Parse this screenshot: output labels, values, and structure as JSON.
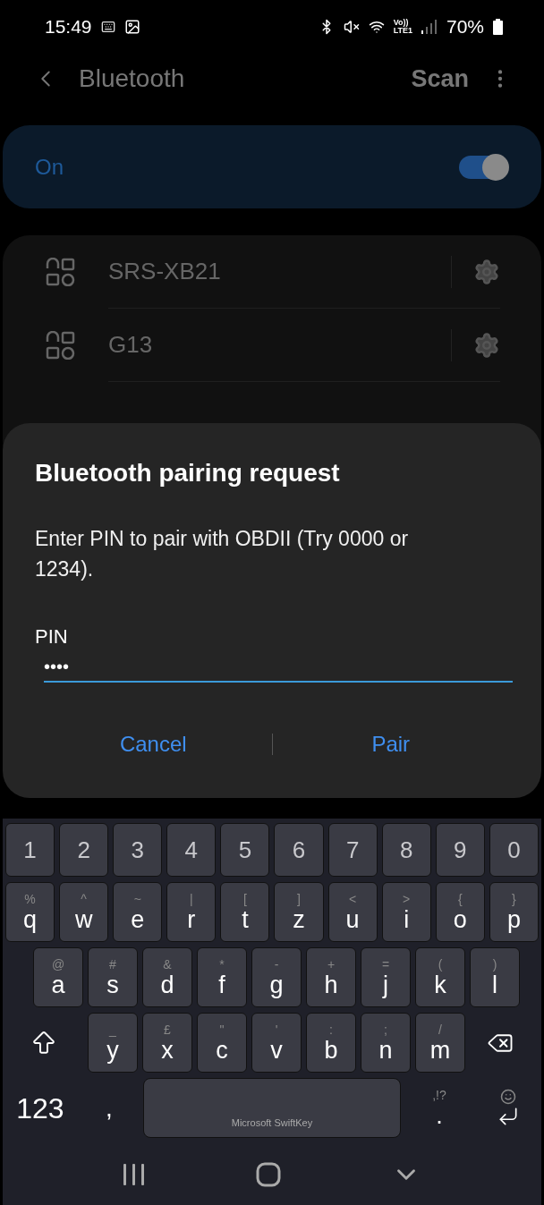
{
  "status_bar": {
    "time": "15:49",
    "volte": "Vo))",
    "network": "LTE1",
    "battery": "70%"
  },
  "app_bar": {
    "title": "Bluetooth",
    "action": "Scan"
  },
  "master_switch": {
    "label": "On",
    "on": true
  },
  "devices": [
    {
      "name": "SRS-XB21"
    },
    {
      "name": "G13"
    }
  ],
  "dialog": {
    "title": "Bluetooth pairing request",
    "message": "Enter PIN to pair with OBDII (Try 0000 or 1234).",
    "field_label": "PIN",
    "field_value": "••••",
    "buttons": [
      "Cancel",
      "Pair"
    ]
  },
  "keyboard": {
    "number_row": [
      "1",
      "2",
      "3",
      "4",
      "5",
      "6",
      "7",
      "8",
      "9",
      "0"
    ],
    "letter_rows": [
      [
        {
          "hint": "%",
          "letter": "q"
        },
        {
          "hint": "^",
          "letter": "w"
        },
        {
          "hint": "~",
          "letter": "e"
        },
        {
          "hint": "|",
          "letter": "r"
        },
        {
          "hint": "[",
          "letter": "t"
        },
        {
          "hint": "]",
          "letter": "z"
        },
        {
          "hint": "<",
          "letter": "u"
        },
        {
          "hint": ">",
          "letter": "i"
        },
        {
          "hint": "{",
          "letter": "o"
        },
        {
          "hint": "}",
          "letter": "p"
        }
      ],
      [
        {
          "hint": "@",
          "letter": "a"
        },
        {
          "hint": "#",
          "letter": "s"
        },
        {
          "hint": "&",
          "letter": "d"
        },
        {
          "hint": "*",
          "letter": "f"
        },
        {
          "hint": "-",
          "letter": "g"
        },
        {
          "hint": "+",
          "letter": "h"
        },
        {
          "hint": "=",
          "letter": "j"
        },
        {
          "hint": "(",
          "letter": "k"
        },
        {
          "hint": ")",
          "letter": "l"
        }
      ],
      [
        {
          "hint": "_",
          "letter": "y"
        },
        {
          "hint": "£",
          "letter": "x"
        },
        {
          "hint": "\"",
          "letter": "c"
        },
        {
          "hint": "'",
          "letter": "v"
        },
        {
          "hint": ":",
          "letter": "b"
        },
        {
          "hint": ";",
          "letter": "n"
        },
        {
          "hint": "/",
          "letter": "m"
        }
      ]
    ],
    "symbols_key": "123",
    "comma_key": ",",
    "space_label": "Microsoft SwiftKey",
    "punct_hint": ",!?",
    "period_key": "."
  }
}
